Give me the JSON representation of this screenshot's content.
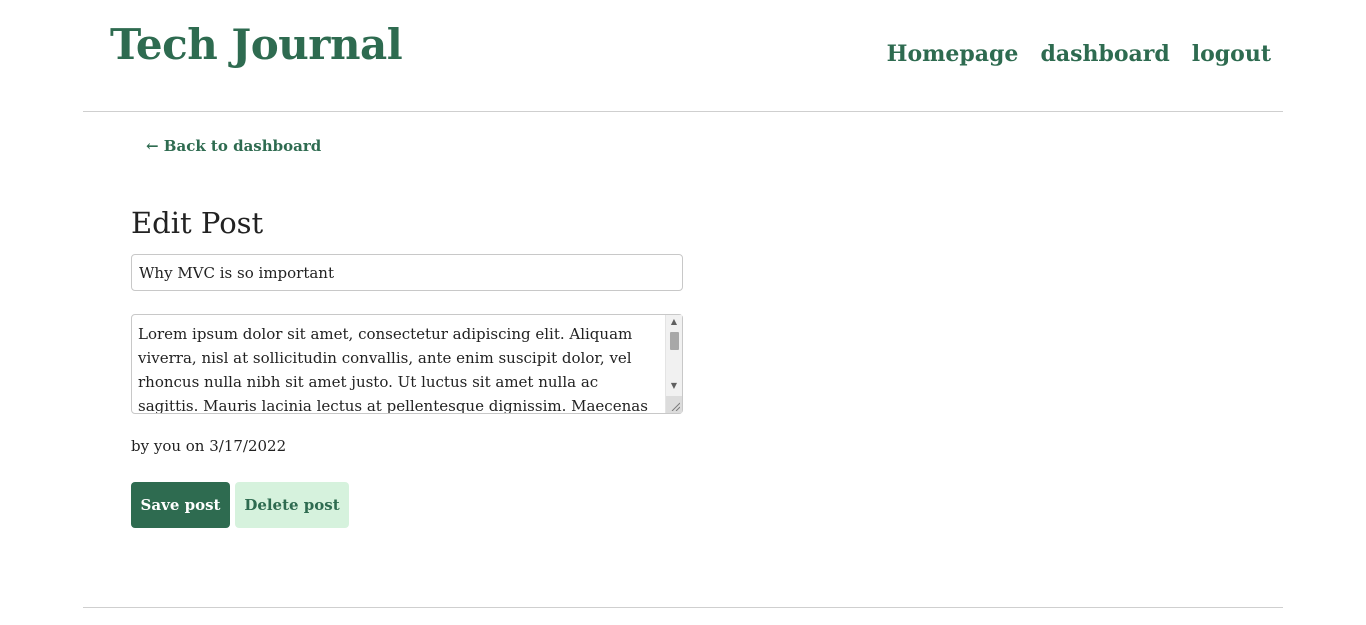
{
  "header": {
    "site_title": "Tech Journal",
    "nav": [
      "Homepage",
      "dashboard",
      "logout"
    ]
  },
  "back_link": "← Back to dashboard",
  "edit": {
    "heading": "Edit Post",
    "title_value": "Why MVC is so important",
    "body_value": "Lorem ipsum dolor sit amet, consectetur adipiscing elit. Aliquam viverra, nisl at sollicitudin convallis, ante enim suscipit dolor, vel rhoncus nulla nibh sit amet justo. Ut luctus sit amet nulla ac sagittis. Mauris lacinia lectus at pellentesque dignissim. Maecenas",
    "byline": "by you on 3/17/2022"
  },
  "buttons": {
    "save": "Save post",
    "delete": "Delete post"
  },
  "colors": {
    "accent": "#2e6b50",
    "delete_bg": "#d6f2dd"
  }
}
